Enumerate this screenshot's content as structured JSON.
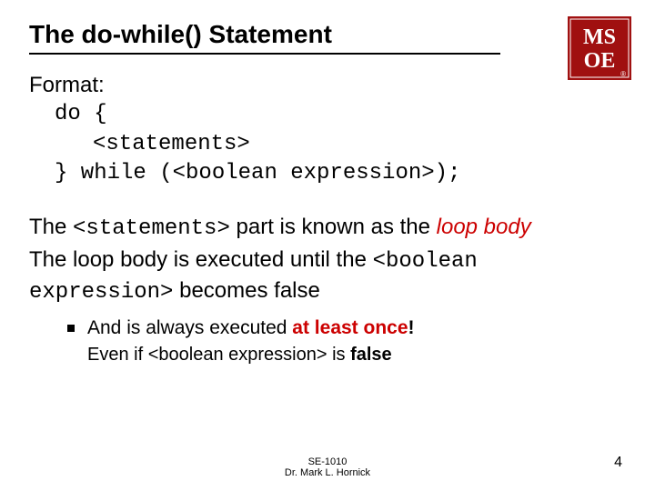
{
  "title": "The do-while() Statement",
  "logo": {
    "text": "MS\nOE",
    "reg": "®"
  },
  "format_label": "Format:",
  "code": {
    "l1": "do {",
    "l2": "<statements>",
    "l3": "} while (<boolean expression>);"
  },
  "p2": {
    "t1": "The ",
    "t2": "<statements>",
    "t3": " part is known as the ",
    "t4": "loop body"
  },
  "p3": {
    "t1": "The loop body is executed until the ",
    "t2": "<boolean expression>",
    "t3": " becomes false"
  },
  "bullet": {
    "t1": "And is always executed ",
    "t2": "at least once",
    "t3": "!"
  },
  "sub": {
    "t1": "Even if <boolean expression> is ",
    "t2": "false"
  },
  "footer": {
    "l1": "SE-1010",
    "l2": "Dr. Mark L. Hornick"
  },
  "page": "4"
}
